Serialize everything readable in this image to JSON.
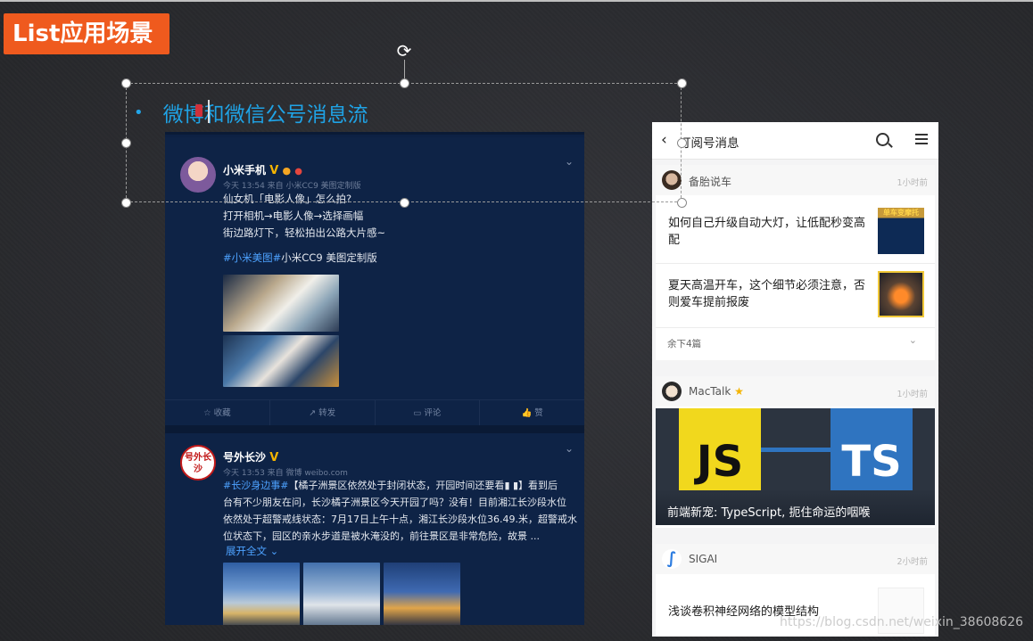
{
  "slide": {
    "title_badge": "List应用场景",
    "bullet_text": "微博和微信公号消息流"
  },
  "weibo": {
    "posts": [
      {
        "author": "小米手机",
        "meta": "今天 13:54 来自 小米CC9 美图定制版",
        "lines": [
          "仙女机「电影人像」怎么拍?",
          "打开相机→电影人像→选择画幅",
          "街边路灯下，轻松拍出公路大片感~"
        ],
        "tags_line_tag": "#小米美图#",
        "tags_line_rest": "小米CC9 美图定制版"
      },
      {
        "author": "号外长沙",
        "avatar_text": "号外长沙",
        "meta": "今天 13:53 来自 微博 weibo.com",
        "tag": "#长沙身边事#",
        "line1_rest": "【橘子洲景区依然处于封闭状态，开园时间还要看",
        "line1_end": "】看到后",
        "line2": "台有不少朋友在问，长沙橘子洲景区今天开园了吗？没有！目前湘江长沙段水位",
        "line3": "依然处于超警戒线状态：7月17日上午十点，湘江长沙段水位36.49.米，超警戒水",
        "line4": "位状态下，园区的亲水步道是被水淹没的，前往景区是非常危险，故景 ...",
        "more": "展开全文 ⌄"
      }
    ],
    "actions": [
      "收藏",
      "转发",
      "评论",
      "赞"
    ]
  },
  "wechat": {
    "header_title": "订阅号消息",
    "accounts": [
      {
        "name": "备胎说车",
        "time": "1小时前",
        "articles": [
          "如何自己升级自动大灯，让低配秒变高配",
          "夏天高温开车，这个细节必须注意，否则爱车提前报废"
        ],
        "thumb1_label": "单车变摩托",
        "remaining": "余下4篇"
      },
      {
        "name": "MacTalk",
        "time": "1小时前",
        "banner_js": "JS",
        "banner_ts": "TS",
        "banner_title": "前端新宠: TypeScript, 扼住命运的咽喉"
      },
      {
        "name": "SIGAI",
        "time": "2小时前",
        "article": "浅谈卷积神经网络的模型结构"
      }
    ]
  },
  "watermark": "https://blog.csdn.net/weixin_38608626",
  "colors": {
    "badge": "#ef5a1e",
    "bullet": "#1fa3e6",
    "weibo_bg": "#0d2143",
    "tag_blue": "#4da2ff"
  }
}
